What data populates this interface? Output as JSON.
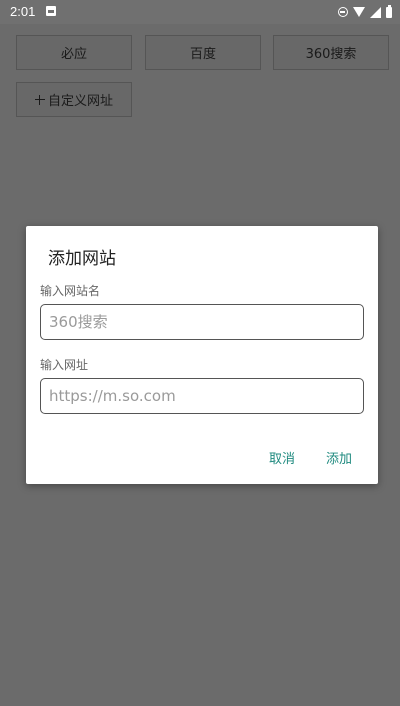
{
  "status_bar": {
    "time": "2:01",
    "icons": [
      "notification-icon",
      "do-not-disturb-icon",
      "wifi-icon",
      "signal-icon",
      "battery-icon"
    ]
  },
  "engines": {
    "items": [
      {
        "label": "必应"
      },
      {
        "label": "百度"
      },
      {
        "label": "360搜索"
      }
    ],
    "custom_label": "自定义网址"
  },
  "dialog": {
    "title": "添加网站",
    "name_label": "输入网站名",
    "name_placeholder": "360搜索",
    "url_label": "输入网址",
    "url_placeholder": "https://m.so.com",
    "cancel_label": "取消",
    "add_label": "添加",
    "accent_color": "#1f8a7f"
  }
}
